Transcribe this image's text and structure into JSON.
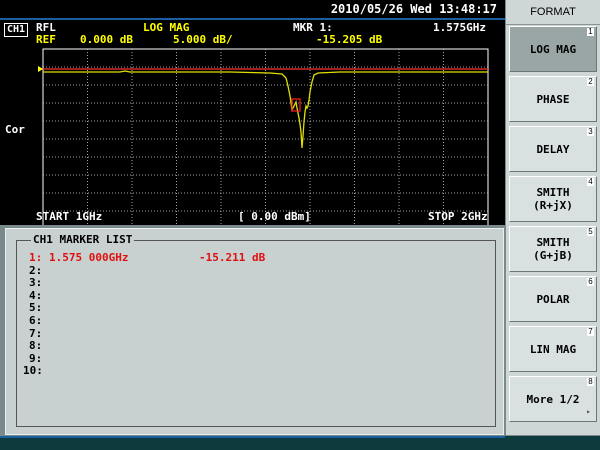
{
  "status": {
    "datetime": "2010/05/26 Wed 13:48:17"
  },
  "trace": {
    "channel_badge": "CH1",
    "measurement": "RFL",
    "format": "LOG MAG",
    "marker_label": "MKR 1:",
    "marker_freq": "1.575GHz",
    "ref_label": "REF",
    "ref_value": "0.000 dB",
    "scale": "5.000 dB/",
    "marker_value": "-15.205 dB",
    "correction": "Cor",
    "start": "START 1GHz",
    "power": "[ 0.00 dBm]",
    "stop": "STOP 2GHz",
    "colors": {
      "trace": "#e0e000",
      "ref_line": "#ff3030",
      "grid": "#cfcfcf",
      "marker": "#ff2020"
    }
  },
  "marker_list": {
    "title": "CH1 MARKER LIST",
    "rows": [
      {
        "num": "1:",
        "freq": "1.575 000GHz",
        "value": "-15.211 dB"
      },
      {
        "num": "2:",
        "freq": "",
        "value": ""
      },
      {
        "num": "3:",
        "freq": "",
        "value": ""
      },
      {
        "num": "4:",
        "freq": "",
        "value": ""
      },
      {
        "num": "5:",
        "freq": "",
        "value": ""
      },
      {
        "num": "6:",
        "freq": "",
        "value": ""
      },
      {
        "num": "7:",
        "freq": "",
        "value": ""
      },
      {
        "num": "8:",
        "freq": "",
        "value": ""
      },
      {
        "num": "9:",
        "freq": "",
        "value": ""
      },
      {
        "num": "10:",
        "freq": "",
        "value": ""
      }
    ]
  },
  "menu": {
    "title": "FORMAT",
    "keys": [
      {
        "label": "LOG MAG",
        "num": "1",
        "active": true
      },
      {
        "label": "PHASE",
        "num": "2"
      },
      {
        "label": "DELAY",
        "num": "3"
      },
      {
        "label": "SMITH\n(R+jX)",
        "num": "4"
      },
      {
        "label": "SMITH\n(G+jB)",
        "num": "5"
      },
      {
        "label": "POLAR",
        "num": "6"
      },
      {
        "label": "LIN MAG",
        "num": "7"
      },
      {
        "label": "More 1/2",
        "num": "8",
        "arrow": "▸"
      }
    ]
  }
}
